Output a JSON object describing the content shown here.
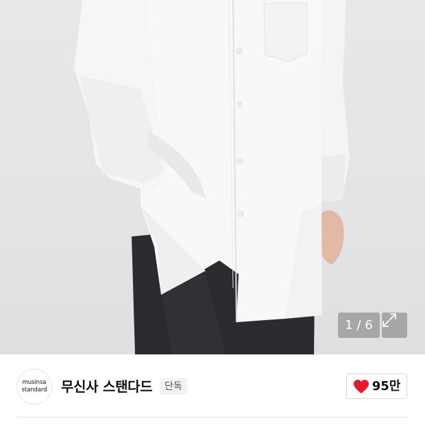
{
  "gallery": {
    "counter": "1 / 6",
    "image_icon": "product-photo-white-shirt",
    "expand_icon": "expand-icon"
  },
  "brand": {
    "logo_line1": "musinsa",
    "logo_line2": "standard",
    "name": "무신사 스탠다드",
    "badge": "단독"
  },
  "like": {
    "icon": "heart-icon",
    "count": "95만",
    "color": "#e8182c"
  }
}
